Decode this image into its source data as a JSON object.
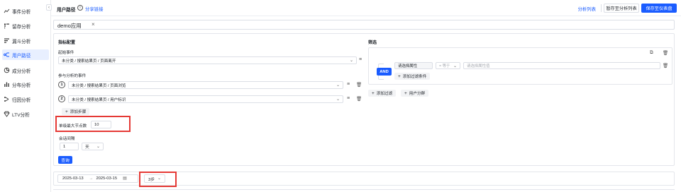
{
  "sidebar": {
    "items": [
      {
        "label": "事件分析",
        "icon": "trend-icon"
      },
      {
        "label": "留存分析",
        "icon": "retention-icon"
      },
      {
        "label": "漏斗分析",
        "icon": "funnel-icon"
      },
      {
        "label": "用户路径",
        "icon": "path-icon",
        "active": true
      },
      {
        "label": "成分分析",
        "icon": "composition-icon"
      },
      {
        "label": "分布分析",
        "icon": "distribution-icon"
      },
      {
        "label": "归因分析",
        "icon": "attribution-icon"
      },
      {
        "label": "LTV分析",
        "icon": "ltv-icon"
      }
    ],
    "collapse_label": "‹"
  },
  "header": {
    "title": "用户路径",
    "help": "i",
    "share_link": "分享链接",
    "analysis_list": "分析列表",
    "save_to_list": "暂存至分析列表",
    "save_to_board": "保存至仪表盘"
  },
  "app_selector": {
    "app_name": "demo应用",
    "close": "×"
  },
  "indicator": {
    "section_title": "指标配置",
    "start_event_label": "起始事件",
    "start_event_value": "未分类 / 搜索结果页 / 页面离开",
    "participating_label": "参与分析的事件",
    "events": [
      {
        "index": "1",
        "value": "未分类 / 搜索结果页 / 页面浏览"
      },
      {
        "index": "2",
        "value": "未分类 / 搜索结果页 / 用户标识"
      }
    ],
    "add_step": "添加步骤",
    "max_nodes_label": "单级最大节点数",
    "max_nodes_value": "10",
    "session_label": "会话间隔",
    "session_value": "1",
    "session_unit": "天",
    "query_button": "查询"
  },
  "filter": {
    "section_title": "筛选",
    "and_label": "AND",
    "property_placeholder": "请选择属性",
    "operator": "= 等于",
    "value_placeholder": "请选择属性值",
    "add_condition": "添加过滤条件",
    "add_filter": "添加过滤",
    "user_group": "用户分群"
  },
  "date_bar": {
    "start_date": "2025-03-13",
    "arrow": "→",
    "end_date": "2025-03-15",
    "steps": "3步"
  },
  "colors": {
    "accent": "#1a5cff",
    "highlight_box": "#e53935"
  }
}
